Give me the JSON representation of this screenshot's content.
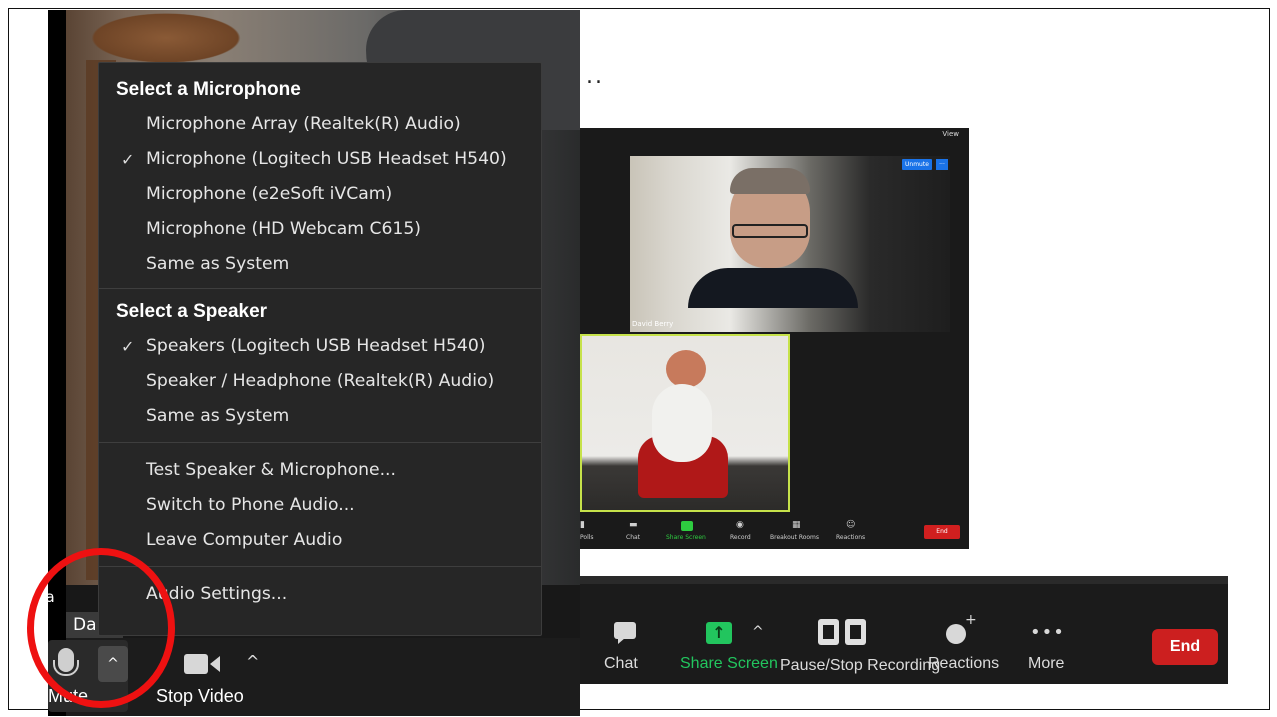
{
  "slide": {
    "ellipsis": ".."
  },
  "left_window": {
    "name_tag": "Da",
    "name_tag_fragment": "Da",
    "audio_menu": {
      "microphone_heading": "Select a Microphone",
      "microphones": [
        {
          "label": "Microphone Array (Realtek(R) Audio)",
          "checked": false
        },
        {
          "label": "Microphone (Logitech USB Headset H540)",
          "checked": true
        },
        {
          "label": "Microphone (e2eSoft iVCam)",
          "checked": false
        },
        {
          "label": "Microphone (HD Webcam C615)",
          "checked": false
        },
        {
          "label": "Same as System",
          "checked": false
        }
      ],
      "speaker_heading": "Select a Speaker",
      "speakers": [
        {
          "label": "Speakers (Logitech USB Headset H540)",
          "checked": true
        },
        {
          "label": "Speaker / Headphone (Realtek(R) Audio)",
          "checked": false
        },
        {
          "label": "Same as System",
          "checked": false
        }
      ],
      "actions": [
        "Test Speaker & Microphone...",
        "Switch to Phone Audio...",
        "Leave Computer Audio"
      ],
      "settings": "Audio Settings...",
      "check_glyph": "✓"
    },
    "toolbar": {
      "mute_label": "Mute",
      "stop_video_label": "Stop Video",
      "caret": "^"
    },
    "highlight_color": "#ee1111"
  },
  "small_window": {
    "view_label": "View",
    "participant_name": "David Berry",
    "unmute_badge": "Unmute",
    "more_badge": "···",
    "toolbar": {
      "polls": "Polls",
      "chat": "Chat",
      "share_screen": "Share Screen",
      "record": "Record",
      "breakout_rooms": "Breakout Rooms",
      "reactions": "Reactions",
      "end": "End"
    },
    "active_speaker_color": "#c6e24a"
  },
  "big_toolbar": {
    "chat": "Chat",
    "share_screen": "Share Screen",
    "pause_stop_recording": "Pause/Stop Recording",
    "reactions": "Reactions",
    "more": "More",
    "end": "End",
    "share_color": "#22c55e",
    "end_color": "#cc1f1f"
  }
}
